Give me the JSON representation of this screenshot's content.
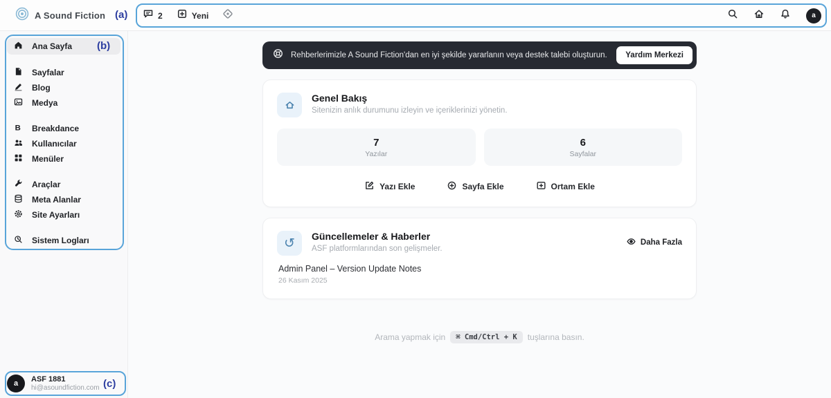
{
  "brand": {
    "name": "A Sound Fiction"
  },
  "topbar": {
    "comments_count": "2",
    "new_label": "Yeni",
    "avatar_letter": "a"
  },
  "annotations": {
    "a": "(a)",
    "b": "(b)",
    "c": "(c)"
  },
  "sidebar": {
    "items": [
      {
        "label": "Ana Sayfa"
      },
      {
        "label": "Sayfalar"
      },
      {
        "label": "Blog"
      },
      {
        "label": "Medya"
      },
      {
        "label": "Breakdance"
      },
      {
        "label": "Kullanıcılar"
      },
      {
        "label": "Menüler"
      },
      {
        "label": "Araçlar"
      },
      {
        "label": "Meta Alanlar"
      },
      {
        "label": "Site Ayarları"
      },
      {
        "label": "Sistem Logları"
      }
    ],
    "user": {
      "name": "ASF 1881",
      "email": "hi@asoundfiction.com",
      "avatar_letter": "a"
    }
  },
  "main": {
    "help_banner": {
      "text": "Rehberlerimizle A Sound Fiction'dan en iyi şekilde yararlanın veya destek talebi oluşturun.",
      "button": "Yardım Merkezi"
    },
    "overview": {
      "title": "Genel Bakış",
      "subtitle": "Sitenizin anlık durumunu izleyin ve içeriklerinizi yönetin.",
      "stats": [
        {
          "value": "7",
          "label": "Yazılar"
        },
        {
          "value": "6",
          "label": "Sayfalar"
        }
      ],
      "actions": [
        {
          "label": "Yazı Ekle"
        },
        {
          "label": "Sayfa Ekle"
        },
        {
          "label": "Ortam Ekle"
        }
      ]
    },
    "updates": {
      "title": "Güncellemeler & Haberler",
      "subtitle": "ASF platformlarından son gelişmeler.",
      "more_label": "Daha Fazla",
      "refresh_glyph": "↺",
      "items": [
        {
          "title": "Admin Panel – Version Update Notes",
          "date": "26 Kasım 2025"
        }
      ]
    },
    "search_hint": {
      "prefix": "Arama yapmak için",
      "kbd": "⌘ Cmd/Ctrl + K",
      "suffix": "tuşlarına basın."
    }
  },
  "colors": {
    "annotation_border": "#58a4d9",
    "annotation_label": "#2c3da0",
    "banner_bg": "#272a32",
    "icon_tile_bg": "#e9f2fa",
    "icon_blue": "#4a82ae",
    "logo_blue": "#8bbad6"
  }
}
